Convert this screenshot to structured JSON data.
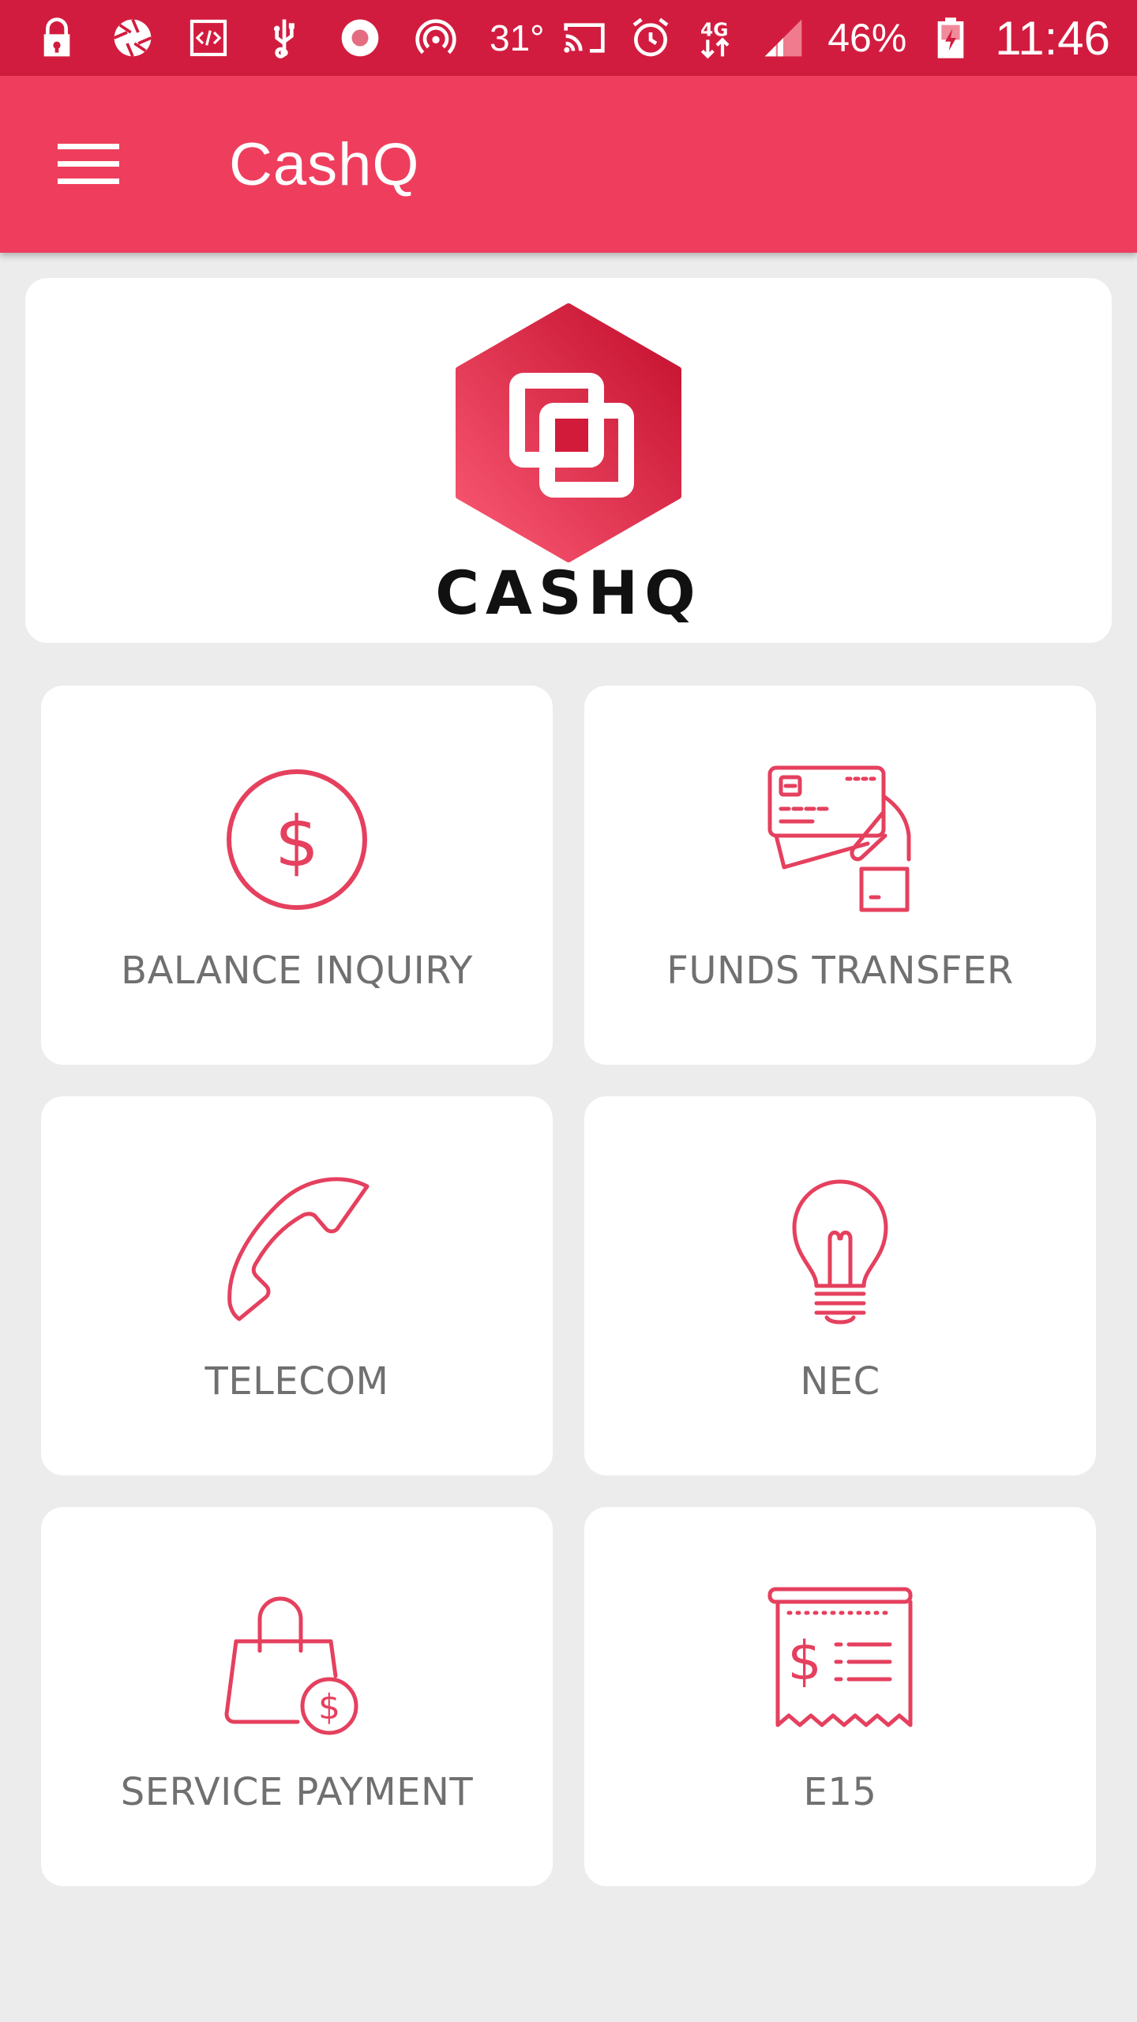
{
  "status_bar": {
    "temperature": "31°",
    "battery": "46%",
    "time": "11:46",
    "network": "4G",
    "icons": [
      "lock-icon",
      "aperture-icon",
      "code-icon",
      "usb-icon",
      "record-icon",
      "hotspot-icon",
      "cast-icon",
      "alarm-icon",
      "network-arrows-icon",
      "signal-icon",
      "battery-charging-icon"
    ]
  },
  "app_bar": {
    "title": "CashQ",
    "menu_icon": "hamburger-menu-icon"
  },
  "logo": {
    "text": "CASHQ",
    "colors": {
      "hex_dark": "#c4102f",
      "hex_light": "#f24b66"
    }
  },
  "tiles": [
    {
      "label": "BALANCE INQUIRY",
      "icon": "dollar-circle-icon"
    },
    {
      "label": "FUNDS TRANSFER",
      "icon": "card-in-hand-icon"
    },
    {
      "label": "TELECOM",
      "icon": "phone-handset-icon"
    },
    {
      "label": "NEC",
      "icon": "light-bulb-icon"
    },
    {
      "label": "SERVICE PAYMENT",
      "icon": "shopping-bag-dollar-icon"
    },
    {
      "label": "E15",
      "icon": "receipt-icon"
    }
  ],
  "colors": {
    "status_bar": "#d21c3f",
    "app_bar": "#ef3e5d",
    "accent": "#e5405e",
    "background": "#ececec",
    "tile_label": "#707070"
  }
}
